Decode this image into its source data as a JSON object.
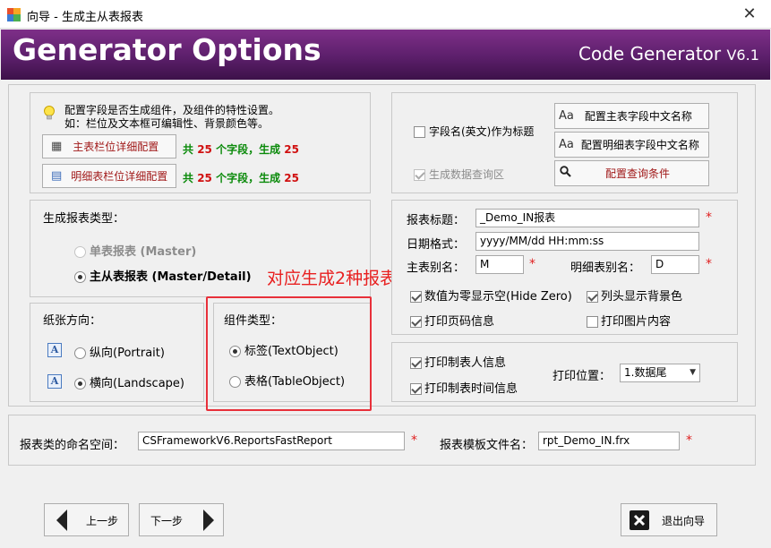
{
  "window": {
    "title": "向导 - 生成主从表报表",
    "close_glyph": "✕"
  },
  "banner": {
    "title": "Generator Options",
    "product": "Code Generator ",
    "version": "V6.1"
  },
  "config_panel": {
    "tip_line1": "配置字段是否生成组件，及组件的特性设置。",
    "tip_line2": "如：栏位及文本框可编辑性、背景颜色等。",
    "master_btn": "主表栏位详细配置",
    "detail_btn": "明细表栏位详细配置",
    "master_stats": {
      "p1": "共 ",
      "n1": "25",
      "p2": " 个字段，生成 ",
      "n2": "25"
    },
    "detail_stats": {
      "p1": "共 ",
      "n1": "25",
      "p2": " 个字段，生成 ",
      "n2": "25"
    }
  },
  "title_panel": {
    "chk_field_title": "字段名(英文)作为标题",
    "chk_query_area": "生成数据查询区",
    "btn_master_cn": "配置主表字段中文名称",
    "btn_detail_cn": "配置明细表字段中文名称",
    "btn_query": "配置查询条件",
    "aa": "Aa"
  },
  "report_type": {
    "heading": "生成报表类型：",
    "single": "单表报表 (Master)",
    "master_detail": "主从表报表 (Master/Detail)"
  },
  "annotation": "对应生成2种报表",
  "paper": {
    "heading": "纸张方向：",
    "portrait": "纵向(Portrait)",
    "landscape": "横向(Landscape)",
    "icon": "A"
  },
  "component": {
    "heading": "组件类型：",
    "text": "标签(TextObject)",
    "table": "表格(TableObject)"
  },
  "report_fields": {
    "title_label": "报表标题：",
    "title_value": "_Demo_IN报表",
    "date_label": "日期格式：",
    "date_value": "yyyy/MM/dd HH:mm:ss",
    "master_alias_label": "主表别名：",
    "master_alias_value": "M",
    "detail_alias_label": "明细表别名：",
    "detail_alias_value": "D",
    "chk_hide_zero": "数值为零显示空(Hide Zero)",
    "chk_col_bg": "列头显示背景色",
    "chk_page_no": "打印页码信息",
    "chk_print_image": "打印图片内容",
    "req": "*"
  },
  "print_panel": {
    "chk_maker": "打印制表人信息",
    "chk_time": "打印制表时间信息",
    "pos_label": "打印位置：",
    "pos_value": "1.数据尾"
  },
  "bottom": {
    "ns_label": "报表类的命名空间：",
    "ns_value": "CSFrameworkV6.ReportsFastReport",
    "tpl_label": "报表模板文件名：",
    "tpl_value": "rpt_Demo_IN.frx"
  },
  "nav": {
    "prev": "上一步",
    "next": "下一步",
    "exit": "退出向导"
  }
}
